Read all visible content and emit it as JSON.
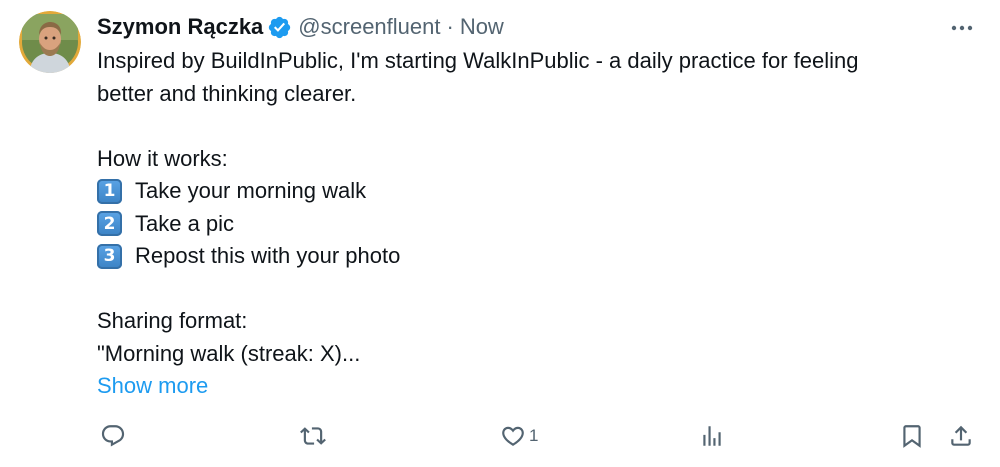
{
  "author": {
    "name": "Szymon Rączka",
    "handle": "@screenfluent",
    "separator": "·",
    "time": "Now"
  },
  "tweet": {
    "intro_line1": "Inspired by BuildInPublic, I'm starting WalkInPublic - a daily practice for feeling",
    "intro_line2": "better and thinking clearer.",
    "how_heading": "How it works:",
    "steps": [
      {
        "num": "1",
        "text": "Take your morning walk"
      },
      {
        "num": "2",
        "text": "Take a pic"
      },
      {
        "num": "3",
        "text": "Repost this with your photo"
      }
    ],
    "format_heading": "Sharing format:",
    "format_line": "\"Morning walk (streak: X)...",
    "show_more": "Show more"
  },
  "actions": {
    "like_count": "1"
  },
  "colors": {
    "text": "#0f1419",
    "secondary": "#536471",
    "link": "#1d9bf0",
    "verified": "#1d9bf0",
    "keycap": "#3b82c4"
  },
  "icons": [
    "verified-badge-icon",
    "more-icon",
    "reply-icon",
    "repost-icon",
    "like-icon",
    "views-icon",
    "bookmark-icon",
    "share-icon"
  ]
}
